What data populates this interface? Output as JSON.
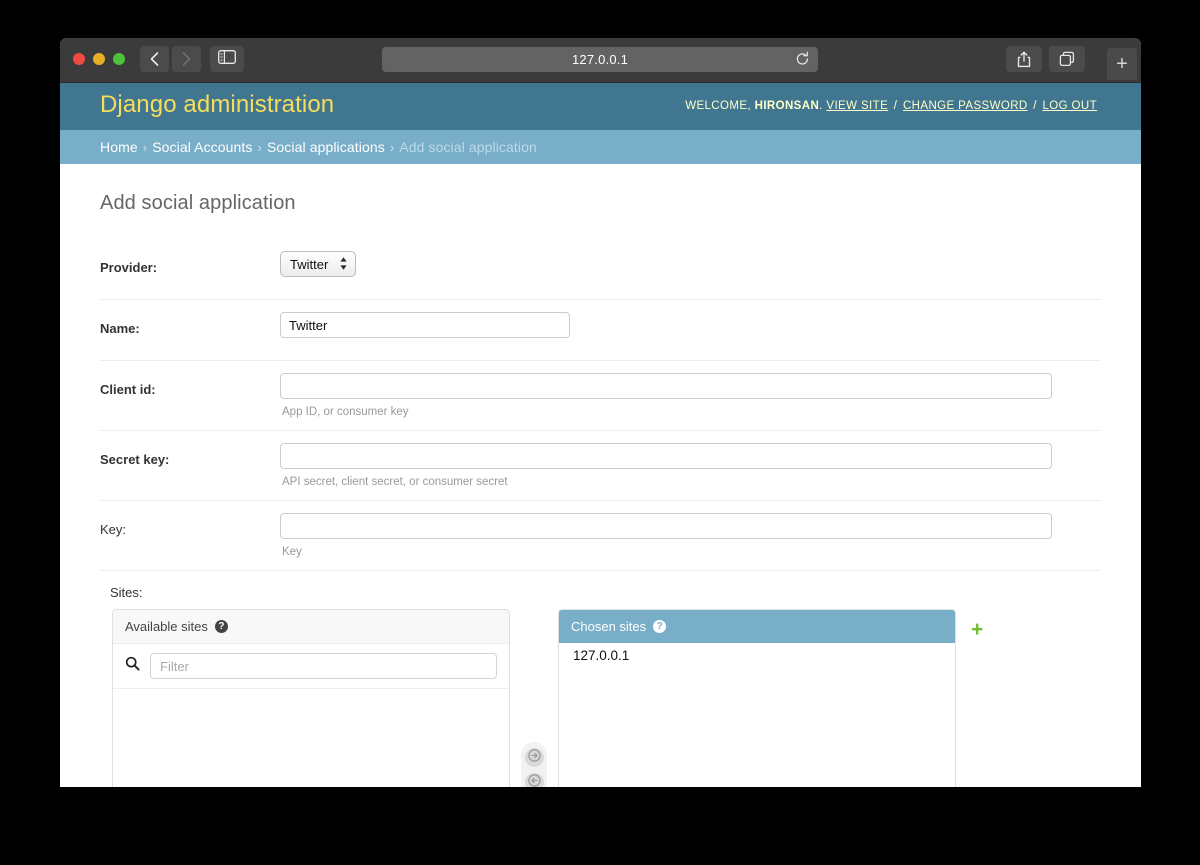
{
  "browser": {
    "url": "127.0.0.1",
    "back_label": "Back",
    "forward_label": "Forward",
    "sidebar_label": "Show sidebar",
    "reload_label": "Reload",
    "share_label": "Share",
    "tabs_label": "Show tab overview",
    "newtab_label": "+"
  },
  "header": {
    "branding": "Django administration",
    "welcome_prefix": "WELCOME,",
    "username": "HIRONSAN",
    "username_suffix": ".",
    "links": [
      {
        "label": "VIEW SITE"
      },
      {
        "label": "CHANGE PASSWORD"
      },
      {
        "label": "LOG OUT"
      }
    ],
    "separator": "/"
  },
  "breadcrumbs": {
    "items": [
      {
        "label": "Home"
      },
      {
        "label": "Social Accounts"
      },
      {
        "label": "Social applications"
      },
      {
        "label": "Add social application"
      }
    ],
    "separator": "›"
  },
  "page": {
    "title": "Add social application"
  },
  "form": {
    "provider": {
      "label": "Provider:",
      "value": "Twitter",
      "options": [
        "Twitter"
      ]
    },
    "name": {
      "label": "Name:",
      "value": "Twitter",
      "placeholder": ""
    },
    "client_id": {
      "label": "Client id:",
      "value": "",
      "help": "App ID, or consumer key"
    },
    "secret_key": {
      "label": "Secret key:",
      "value": "",
      "help": "API secret, client secret, or consumer secret"
    },
    "key": {
      "label": "Key:",
      "value": "",
      "help": "Key"
    },
    "sites": {
      "label": "Sites:",
      "available_title": "Available sites",
      "chosen_title": "Chosen sites",
      "help_glyph": "?",
      "filter_placeholder": "Filter",
      "available_items": [],
      "chosen_items": [
        "127.0.0.1"
      ],
      "add_all_label": "Add",
      "remove_all_label": "Remove",
      "add_another_label": "+"
    }
  },
  "colors": {
    "header_bg": "#417690",
    "breadcrumb_bg": "#79aec8",
    "branding_text": "#f5dd5d",
    "accent_green": "#70bf2b"
  }
}
